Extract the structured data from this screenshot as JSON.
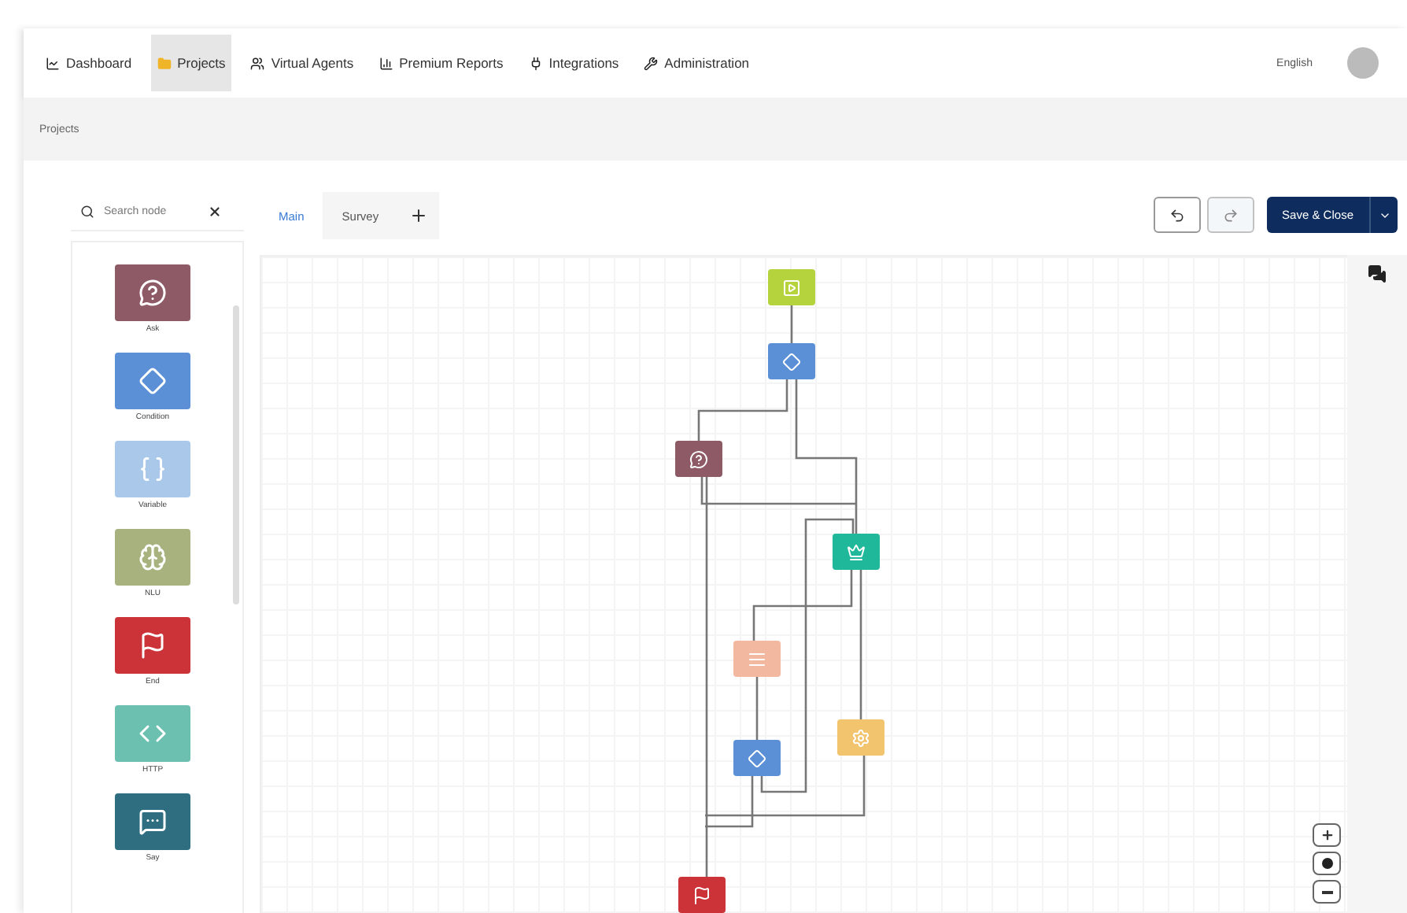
{
  "nav": {
    "items": [
      {
        "label": "Dashboard",
        "selected": false
      },
      {
        "label": "Projects",
        "selected": true
      },
      {
        "label": "Virtual Agents",
        "selected": false
      },
      {
        "label": "Premium Reports",
        "selected": false
      },
      {
        "label": "Integrations",
        "selected": false
      },
      {
        "label": "Administration",
        "selected": false
      }
    ],
    "language": "English"
  },
  "breadcrumb": "Projects",
  "palette": {
    "search": {
      "placeholder": "Search node"
    },
    "nodes": [
      {
        "label": "Ask",
        "kind": "ask"
      },
      {
        "label": "Condition",
        "kind": "condition"
      },
      {
        "label": "Variable",
        "kind": "variable"
      },
      {
        "label": "NLU",
        "kind": "nlu"
      },
      {
        "label": "End",
        "kind": "end"
      },
      {
        "label": "HTTP",
        "kind": "http"
      },
      {
        "label": "Say",
        "kind": "say"
      }
    ]
  },
  "tabs": [
    {
      "label": "Main",
      "selected": true
    },
    {
      "label": "Survey",
      "selected": false
    }
  ],
  "toolbar": {
    "undo_disabled": false,
    "redo_disabled": true,
    "save": "Save & Close"
  },
  "canvas": {
    "nodes": [
      {
        "kind": "start"
      },
      {
        "kind": "condition"
      },
      {
        "kind": "ask"
      },
      {
        "kind": "intent"
      },
      {
        "kind": "list"
      },
      {
        "kind": "condition"
      },
      {
        "kind": "action"
      },
      {
        "kind": "end"
      }
    ]
  }
}
